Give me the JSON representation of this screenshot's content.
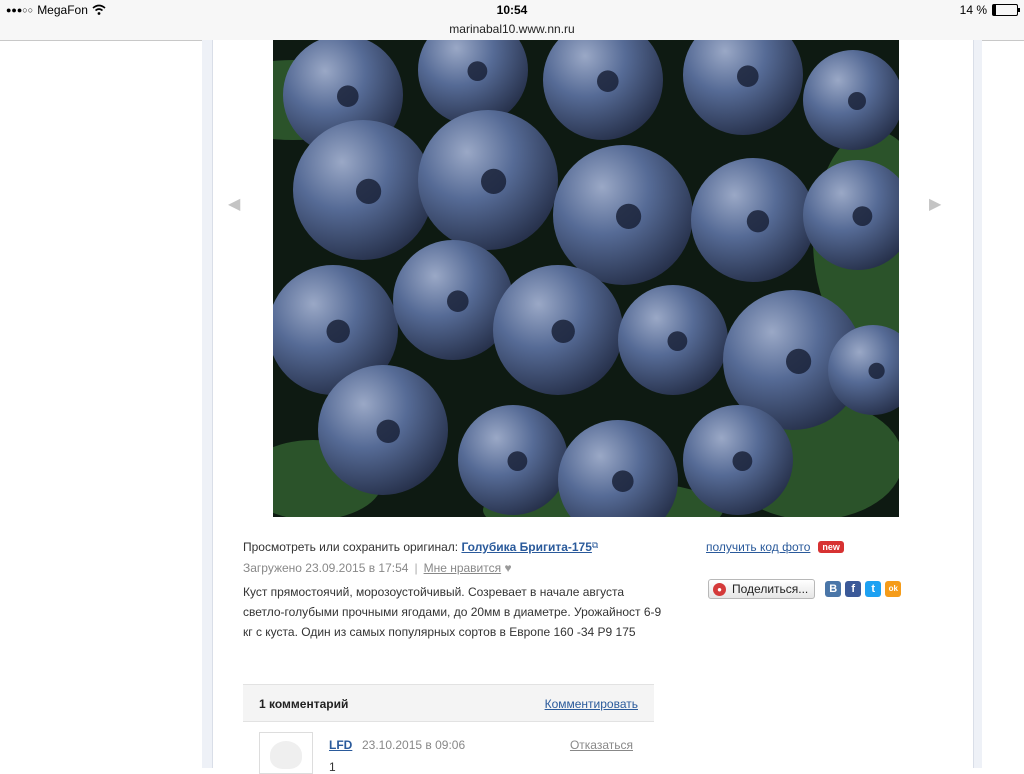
{
  "statusbar": {
    "signal": "●●●○○",
    "carrier": "MegaFon",
    "time": "10:54",
    "battery_text": "14 %",
    "battery_level": 0.14
  },
  "address": {
    "url": "marinabal10.www.nn.ru"
  },
  "nav": {
    "prev": "◀",
    "next": "▶"
  },
  "photo": {
    "colors": {
      "berry": "#566b96",
      "leaf": "#2f5a2e",
      "shadow": "#0e1a12"
    }
  },
  "info": {
    "view_prefix": "Просмотреть или сохранить оригинал:",
    "original_link": "Голубика Бригита-175",
    "uploaded": "Загружено 23.09.2015 в 17:54",
    "separator": "|",
    "like": "Мне нравится",
    "description": "Куст прямостоячий, морозоустойчивый. Созревает в начале августа светло-голубыми прочными ягодами, до 20мм в диаметре. Урожайност 6-9 кг с куста. Один из самых популярных сортов в Европе 160 -34 Р9 175"
  },
  "tools": {
    "get_code": "получить код фото",
    "new_badge": "new",
    "share": "Поделиться...",
    "social": {
      "vk": "B",
      "fb": "f",
      "tw": "t",
      "ok": "ok"
    }
  },
  "comments": {
    "title": "1 комментарий",
    "action": "Комментировать",
    "items": [
      {
        "author": "LFD",
        "date": "23.10.2015 в 09:06",
        "action": "Отказаться",
        "text": "1"
      }
    ]
  },
  "colors": {
    "link": "#2a5a9b",
    "badge": "#d73232"
  }
}
